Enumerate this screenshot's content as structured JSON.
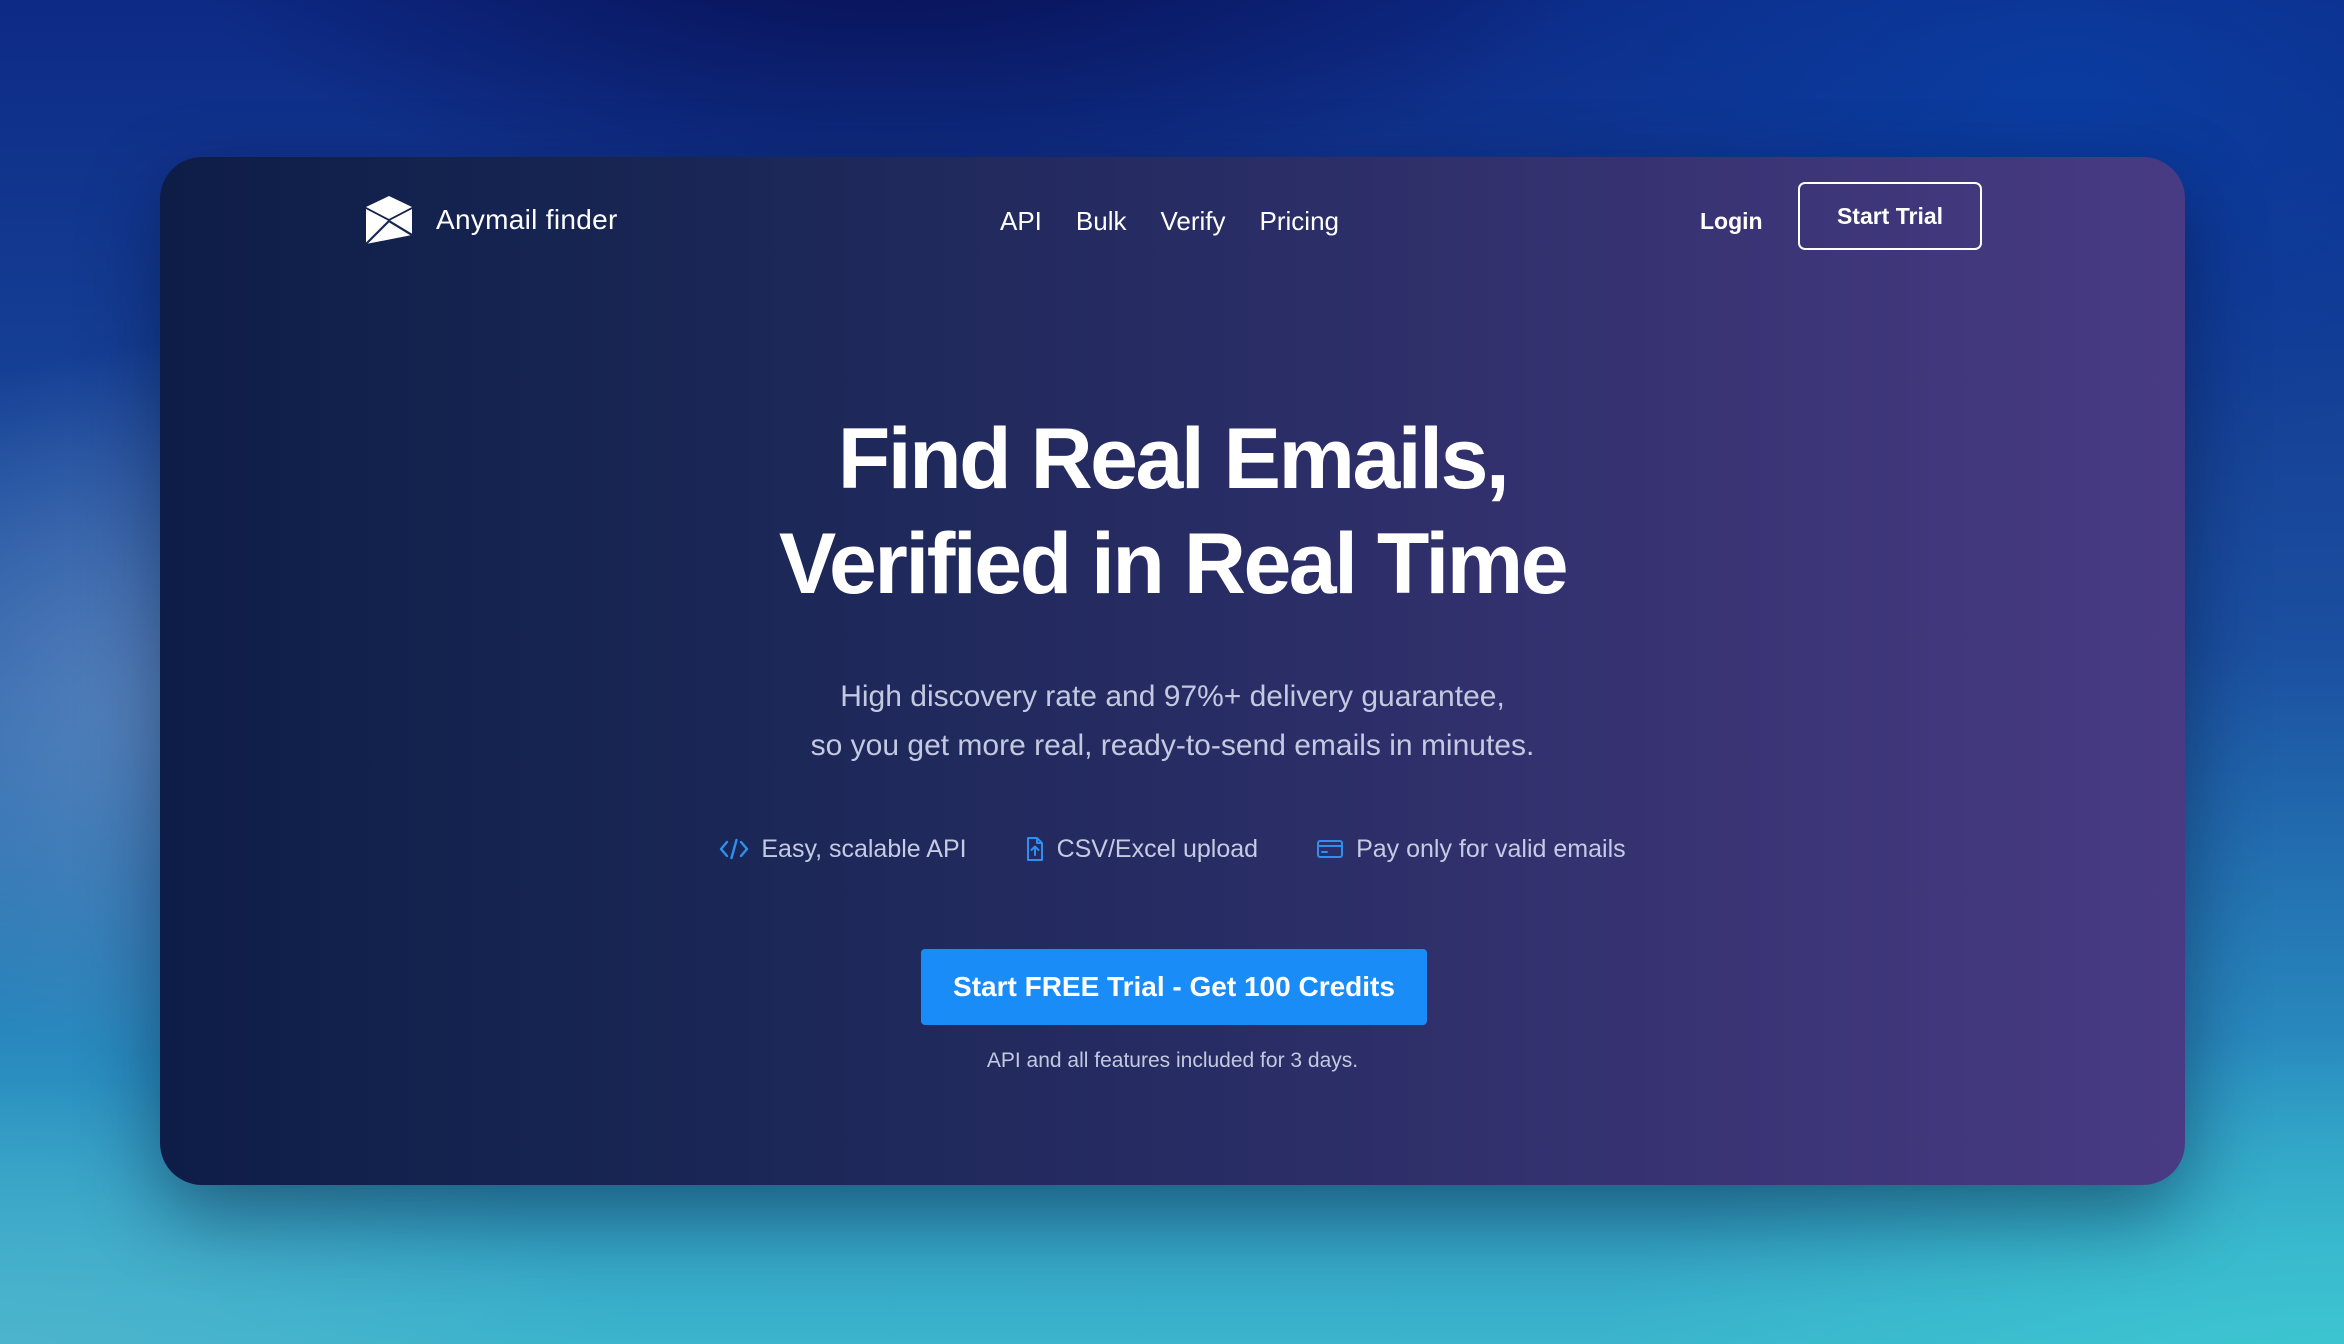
{
  "brand": {
    "name": "Anymail finder",
    "logo_icon": "envelope-logo-icon"
  },
  "nav": {
    "links": [
      "API",
      "Bulk",
      "Verify",
      "Pricing"
    ],
    "login_label": "Login",
    "start_trial_label": "Start Trial"
  },
  "hero": {
    "headline_line1": "Find Real Emails,",
    "headline_line2": "Verified in Real Time",
    "sub_line1": "High discovery rate and 97%+ delivery guarantee,",
    "sub_line2": "so you get more real, ready-to-send emails in minutes.",
    "features": [
      {
        "icon": "code-icon",
        "label": "Easy, scalable API"
      },
      {
        "icon": "file-upload-icon",
        "label": "CSV/Excel upload"
      },
      {
        "icon": "credit-card-icon",
        "label": "Pay only for valid emails"
      }
    ],
    "cta_label": "Start FREE Trial - Get 100 Credits",
    "cta_note": "API and all features included for 3 days."
  },
  "colors": {
    "accent": "#1a8cf7",
    "feature_icon": "#2f8ff0",
    "card_left": "#0e1d47",
    "card_right": "#483b84"
  }
}
